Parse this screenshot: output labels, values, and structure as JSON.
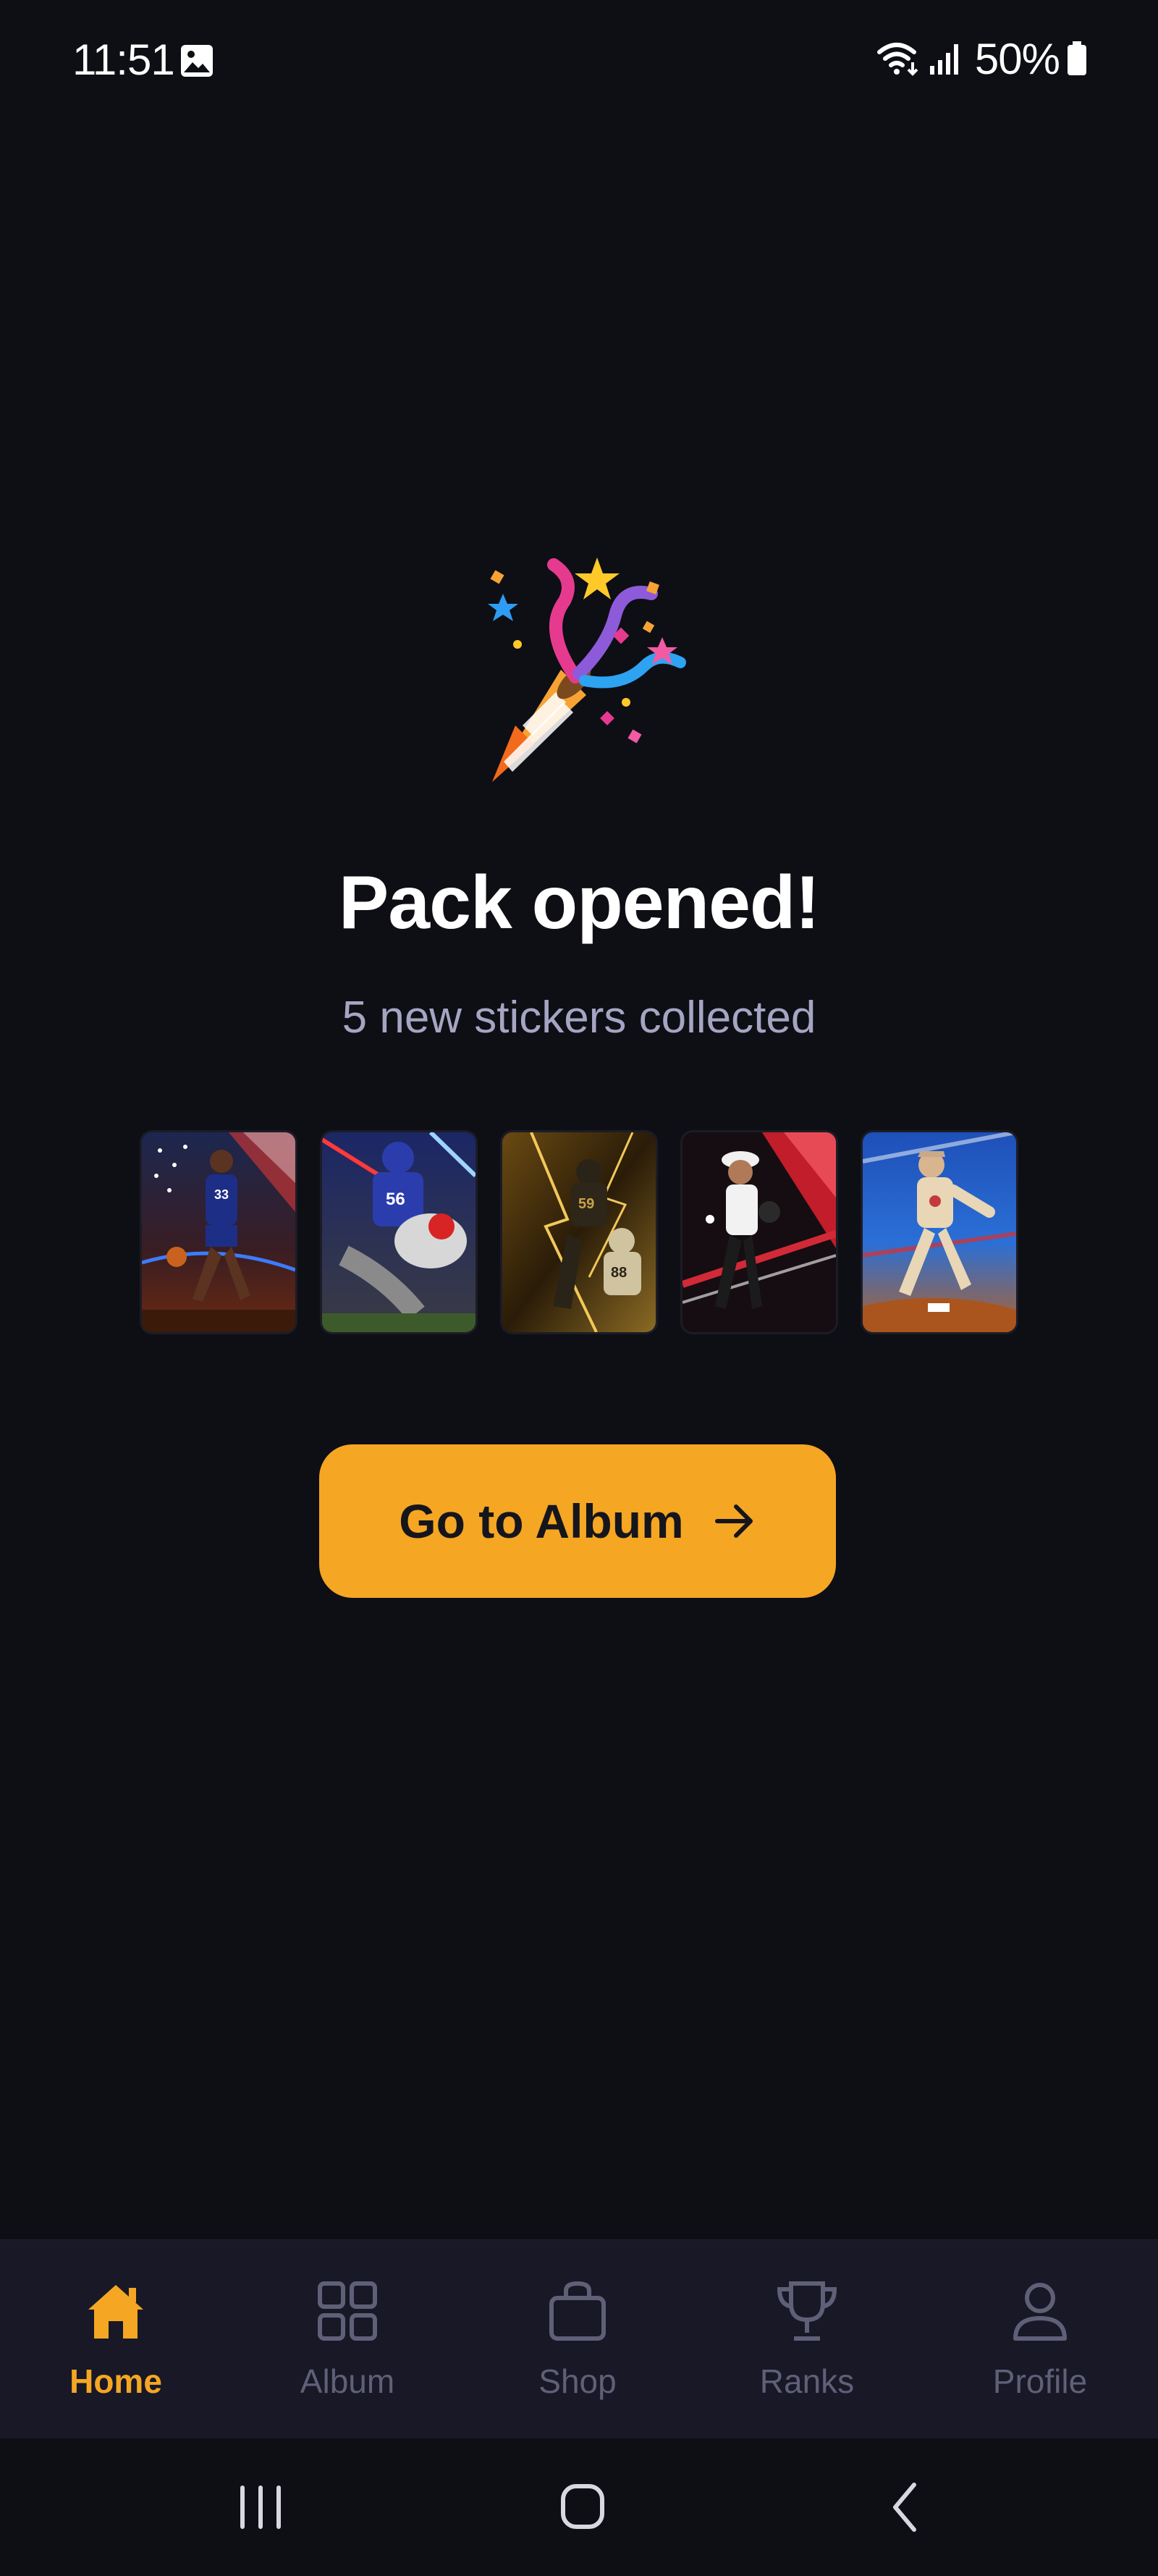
{
  "status_bar": {
    "time": "11:51",
    "battery": "50%",
    "icons": [
      "image-icon",
      "wifi-icon",
      "signal-icon",
      "battery-icon"
    ]
  },
  "celebration": {
    "icon": "party-popper-icon",
    "title": "Pack opened!",
    "subtitle": "5 new stickers collected"
  },
  "stickers": [
    {
      "sport": "basketball",
      "jersey": "33"
    },
    {
      "sport": "american-football",
      "jersey": "56"
    },
    {
      "sport": "american-football",
      "jersey": "59"
    },
    {
      "sport": "softball",
      "jersey": ""
    },
    {
      "sport": "baseball",
      "jersey": ""
    }
  ],
  "cta": {
    "label": "Go to Album",
    "icon": "arrow-right-icon"
  },
  "bottom_nav": {
    "items": [
      {
        "label": "Home",
        "icon": "home-icon",
        "active": true
      },
      {
        "label": "Album",
        "icon": "grid-icon",
        "active": false
      },
      {
        "label": "Shop",
        "icon": "shopping-bag-icon",
        "active": false
      },
      {
        "label": "Ranks",
        "icon": "trophy-icon",
        "active": false
      },
      {
        "label": "Profile",
        "icon": "user-icon",
        "active": false
      }
    ]
  },
  "system_nav": {
    "icons": [
      "recent-apps-icon",
      "home-circle-icon",
      "back-icon"
    ]
  },
  "colors": {
    "background": "#0e0e15",
    "accent": "#f5a623",
    "nav_background": "#181826",
    "muted_text": "#a5a5c3",
    "inactive_nav": "#5f5f78"
  }
}
